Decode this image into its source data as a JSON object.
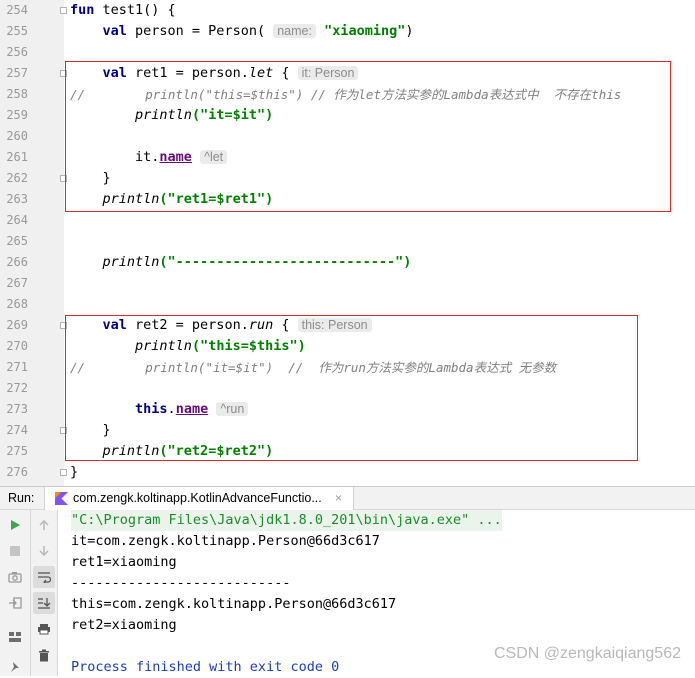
{
  "editor": {
    "line_numbers": [
      "254",
      "255",
      "256",
      "257",
      "258",
      "259",
      "260",
      "261",
      "262",
      "263",
      "264",
      "265",
      "266",
      "267",
      "268",
      "269",
      "270",
      "271",
      "272",
      "273",
      "274",
      "275",
      "276"
    ],
    "hints": {
      "name_param": "name:",
      "it_person": "it: Person",
      "let_label": "^let",
      "this_person": "this: Person",
      "run_label": "^run"
    },
    "lines": {
      "l254_fun": "fun",
      "l254_rest": " test1() {",
      "l255_val": "val",
      "l255_a": " person = Person( ",
      "l255_str": "\"xiaoming\"",
      "l255_b": ")",
      "l257_val": "val",
      "l257_a": " ret1 = person.",
      "l257_let": "let",
      "l257_b": " { ",
      "l258_comment": "//        println(\"this=$this\") // 作为let方法实参的Lambda表达式中  不存在this",
      "l259_fn": "println",
      "l259_str": "(\"it=$it\")",
      "l261_it": "it.",
      "l261_name": "name",
      "l262_brace": "}",
      "l263_fn": "println",
      "l263_str": "(\"ret1=$ret1\")",
      "l266_fn": "println",
      "l266_str": "(\"---------------------------\")",
      "l269_val": "val",
      "l269_a": " ret2 = person.",
      "l269_run": "run",
      "l269_b": " { ",
      "l270_fn": "println",
      "l270_str": "(\"this=$this\")",
      "l271_comment": "//        println(\"it=$it\")  //  作为run方法实参的Lambda表达式 无参数",
      "l273_this": "this",
      "l273_dot": ".",
      "l273_name": "name",
      "l274_brace": "}",
      "l275_fn": "println",
      "l275_str": "(\"ret2=$ret2\")",
      "l276_brace": "}"
    }
  },
  "run_panel": {
    "label": "Run:",
    "tab_title": "com.zengk.koltinapp.KotlinAdvanceFunctio...",
    "tab_close": "×",
    "output": [
      "\"C:\\Program Files\\Java\\jdk1.8.0_201\\bin\\java.exe\" ...",
      "it=com.zengk.koltinapp.Person@66d3c617",
      "ret1=xiaoming",
      "---------------------------",
      "this=com.zengk.koltinapp.Person@66d3c617",
      "ret2=xiaoming",
      "",
      "Process finished with exit code 0"
    ]
  },
  "watermark": "CSDN @zengkaiqiang562",
  "colors": {
    "keyword": "#000080",
    "string": "#008000",
    "comment": "#808080",
    "property": "#660e7a",
    "highlight_box": "#dd2a2a",
    "process_text": "#1c3fb0"
  }
}
